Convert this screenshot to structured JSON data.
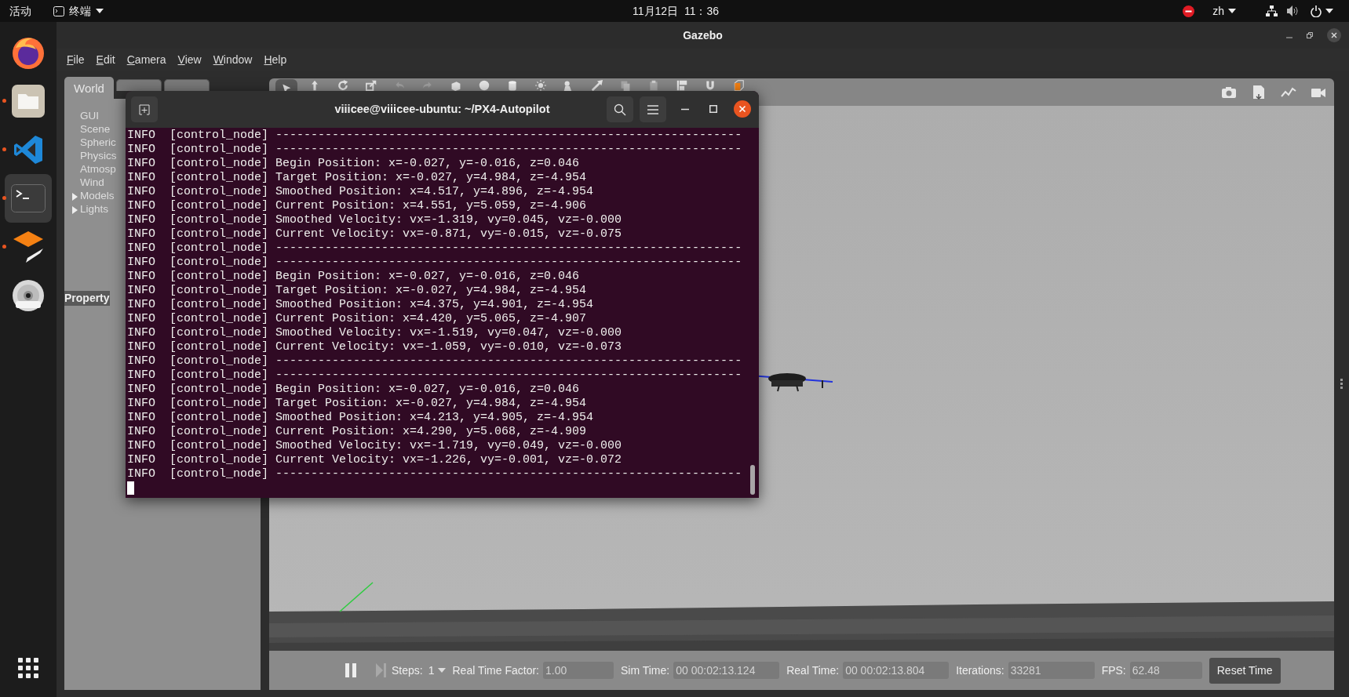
{
  "top_bar": {
    "activities": "活动",
    "app_menu": "终端",
    "clock": "11月12日  11：36",
    "input_method": "zh"
  },
  "dock": [
    {
      "kind": "firefox",
      "running": false,
      "selected": false
    },
    {
      "kind": "files",
      "running": true,
      "selected": false
    },
    {
      "kind": "vscode",
      "running": true,
      "selected": false
    },
    {
      "kind": "terminal",
      "running": true,
      "selected": true
    },
    {
      "kind": "gazebo",
      "running": true,
      "selected": false
    },
    {
      "kind": "dvd",
      "running": false,
      "selected": false
    }
  ],
  "gazebo": {
    "title": "Gazebo",
    "menu": [
      "File",
      "Edit",
      "Camera",
      "View",
      "Window",
      "Help"
    ],
    "panel_tabs": [
      {
        "label": "World",
        "selected": true
      },
      {
        "selected": false
      },
      {
        "selected": false
      }
    ],
    "world_tree": [
      {
        "label": "GUI",
        "expandable": false
      },
      {
        "label": "Scene",
        "expandable": false
      },
      {
        "label": "Spheric",
        "expandable": false
      },
      {
        "label": "Physics",
        "expandable": false
      },
      {
        "label": "Atmosp",
        "expandable": false
      },
      {
        "label": "Wind",
        "expandable": false
      },
      {
        "label": "Models",
        "expandable": true
      },
      {
        "label": "Lights",
        "expandable": true
      }
    ],
    "property_header": "Property",
    "tools": [
      {
        "kind": "select",
        "selected": true
      },
      {
        "kind": "translate",
        "selected": false
      },
      {
        "kind": "rotate",
        "selected": false
      },
      {
        "kind": "scale",
        "selected": false
      },
      {
        "kind": "undo",
        "selected": false
      },
      {
        "kind": "redo",
        "selected": false
      },
      {
        "kind": "box",
        "selected": false
      },
      {
        "kind": "sphere",
        "selected": false
      },
      {
        "kind": "cylinder",
        "selected": false
      },
      {
        "kind": "pointlight",
        "selected": false
      },
      {
        "kind": "spotlight",
        "selected": false
      },
      {
        "kind": "dirlight",
        "selected": false
      },
      {
        "kind": "copy",
        "selected": false
      },
      {
        "kind": "paste",
        "selected": false
      },
      {
        "kind": "align",
        "selected": false
      },
      {
        "kind": "snap",
        "selected": false
      },
      {
        "kind": "view",
        "selected": false
      }
    ],
    "right_tools": [
      {
        "kind": "screenshot"
      },
      {
        "kind": "log"
      },
      {
        "kind": "plot"
      },
      {
        "kind": "video"
      }
    ],
    "steps": {
      "label": "Steps:",
      "value": "1"
    },
    "readouts": [
      {
        "label": "Real Time Factor:",
        "value": "1.00"
      },
      {
        "label": "Sim Time:",
        "value": "00 00:02:13.124"
      },
      {
        "label": "Real Time:",
        "value": "00 00:02:13.804"
      },
      {
        "label": "Iterations:",
        "value": "33281"
      },
      {
        "label": "FPS:",
        "value": "62.48"
      }
    ],
    "reset_button": "Reset Time"
  },
  "terminal": {
    "title": "viiicee@viiicee-ubuntu: ~/PX4-Autopilot",
    "cursor": true,
    "lines": [
      "INFO  [control_node] ------------------------------------------------------------------",
      "INFO  [control_node] ------------------------------------------------------------------",
      "INFO  [control_node] Begin Position: x=-0.027, y=-0.016, z=0.046",
      "INFO  [control_node] Target Position: x=-0.027, y=4.984, z=-4.954",
      "INFO  [control_node] Smoothed Position: x=4.517, y=4.896, z=-4.954",
      "INFO  [control_node] Current Position: x=4.551, y=5.059, z=-4.906",
      "INFO  [control_node] Smoothed Velocity: vx=-1.319, vy=0.045, vz=-0.000",
      "INFO  [control_node] Current Velocity: vx=-0.871, vy=-0.015, vz=-0.075",
      "INFO  [control_node] ------------------------------------------------------------------",
      "INFO  [control_node] ------------------------------------------------------------------",
      "INFO  [control_node] Begin Position: x=-0.027, y=-0.016, z=0.046",
      "INFO  [control_node] Target Position: x=-0.027, y=4.984, z=-4.954",
      "INFO  [control_node] Smoothed Position: x=4.375, y=4.901, z=-4.954",
      "INFO  [control_node] Current Position: x=4.420, y=5.065, z=-4.907",
      "INFO  [control_node] Smoothed Velocity: vx=-1.519, vy=0.047, vz=-0.000",
      "INFO  [control_node] Current Velocity: vx=-1.059, vy=-0.010, vz=-0.073",
      "INFO  [control_node] ------------------------------------------------------------------",
      "INFO  [control_node] ------------------------------------------------------------------",
      "INFO  [control_node] Begin Position: x=-0.027, y=-0.016, z=0.046",
      "INFO  [control_node] Target Position: x=-0.027, y=4.984, z=-4.954",
      "INFO  [control_node] Smoothed Position: x=4.213, y=4.905, z=-4.954",
      "INFO  [control_node] Current Position: x=4.290, y=5.068, z=-4.909",
      "INFO  [control_node] Smoothed Velocity: vx=-1.719, vy=0.049, vz=-0.000",
      "INFO  [control_node] Current Velocity: vx=-1.226, vy=-0.001, vz=-0.072",
      "INFO  [control_node] ------------------------------------------------------------------"
    ]
  }
}
